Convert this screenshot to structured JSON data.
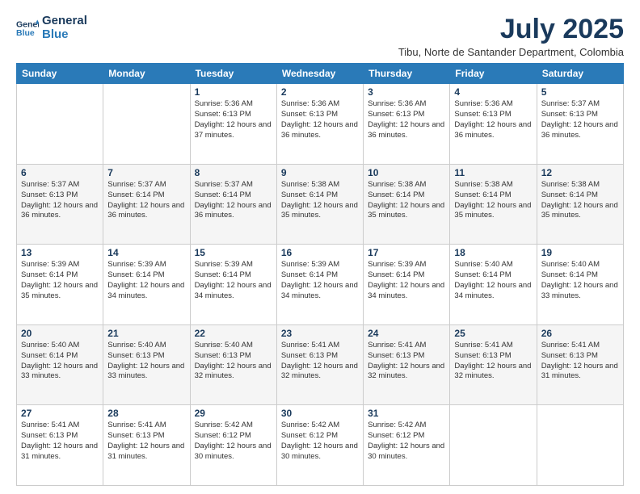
{
  "logo": {
    "line1": "General",
    "line2": "Blue"
  },
  "title": "July 2025",
  "subtitle": "Tibu, Norte de Santander Department, Colombia",
  "weekdays": [
    "Sunday",
    "Monday",
    "Tuesday",
    "Wednesday",
    "Thursday",
    "Friday",
    "Saturday"
  ],
  "weeks": [
    [
      {
        "day": "",
        "info": ""
      },
      {
        "day": "",
        "info": ""
      },
      {
        "day": "1",
        "info": "Sunrise: 5:36 AM\nSunset: 6:13 PM\nDaylight: 12 hours and 37 minutes."
      },
      {
        "day": "2",
        "info": "Sunrise: 5:36 AM\nSunset: 6:13 PM\nDaylight: 12 hours and 36 minutes."
      },
      {
        "day": "3",
        "info": "Sunrise: 5:36 AM\nSunset: 6:13 PM\nDaylight: 12 hours and 36 minutes."
      },
      {
        "day": "4",
        "info": "Sunrise: 5:36 AM\nSunset: 6:13 PM\nDaylight: 12 hours and 36 minutes."
      },
      {
        "day": "5",
        "info": "Sunrise: 5:37 AM\nSunset: 6:13 PM\nDaylight: 12 hours and 36 minutes."
      }
    ],
    [
      {
        "day": "6",
        "info": "Sunrise: 5:37 AM\nSunset: 6:13 PM\nDaylight: 12 hours and 36 minutes."
      },
      {
        "day": "7",
        "info": "Sunrise: 5:37 AM\nSunset: 6:14 PM\nDaylight: 12 hours and 36 minutes."
      },
      {
        "day": "8",
        "info": "Sunrise: 5:37 AM\nSunset: 6:14 PM\nDaylight: 12 hours and 36 minutes."
      },
      {
        "day": "9",
        "info": "Sunrise: 5:38 AM\nSunset: 6:14 PM\nDaylight: 12 hours and 35 minutes."
      },
      {
        "day": "10",
        "info": "Sunrise: 5:38 AM\nSunset: 6:14 PM\nDaylight: 12 hours and 35 minutes."
      },
      {
        "day": "11",
        "info": "Sunrise: 5:38 AM\nSunset: 6:14 PM\nDaylight: 12 hours and 35 minutes."
      },
      {
        "day": "12",
        "info": "Sunrise: 5:38 AM\nSunset: 6:14 PM\nDaylight: 12 hours and 35 minutes."
      }
    ],
    [
      {
        "day": "13",
        "info": "Sunrise: 5:39 AM\nSunset: 6:14 PM\nDaylight: 12 hours and 35 minutes."
      },
      {
        "day": "14",
        "info": "Sunrise: 5:39 AM\nSunset: 6:14 PM\nDaylight: 12 hours and 34 minutes."
      },
      {
        "day": "15",
        "info": "Sunrise: 5:39 AM\nSunset: 6:14 PM\nDaylight: 12 hours and 34 minutes."
      },
      {
        "day": "16",
        "info": "Sunrise: 5:39 AM\nSunset: 6:14 PM\nDaylight: 12 hours and 34 minutes."
      },
      {
        "day": "17",
        "info": "Sunrise: 5:39 AM\nSunset: 6:14 PM\nDaylight: 12 hours and 34 minutes."
      },
      {
        "day": "18",
        "info": "Sunrise: 5:40 AM\nSunset: 6:14 PM\nDaylight: 12 hours and 34 minutes."
      },
      {
        "day": "19",
        "info": "Sunrise: 5:40 AM\nSunset: 6:14 PM\nDaylight: 12 hours and 33 minutes."
      }
    ],
    [
      {
        "day": "20",
        "info": "Sunrise: 5:40 AM\nSunset: 6:14 PM\nDaylight: 12 hours and 33 minutes."
      },
      {
        "day": "21",
        "info": "Sunrise: 5:40 AM\nSunset: 6:13 PM\nDaylight: 12 hours and 33 minutes."
      },
      {
        "day": "22",
        "info": "Sunrise: 5:40 AM\nSunset: 6:13 PM\nDaylight: 12 hours and 32 minutes."
      },
      {
        "day": "23",
        "info": "Sunrise: 5:41 AM\nSunset: 6:13 PM\nDaylight: 12 hours and 32 minutes."
      },
      {
        "day": "24",
        "info": "Sunrise: 5:41 AM\nSunset: 6:13 PM\nDaylight: 12 hours and 32 minutes."
      },
      {
        "day": "25",
        "info": "Sunrise: 5:41 AM\nSunset: 6:13 PM\nDaylight: 12 hours and 32 minutes."
      },
      {
        "day": "26",
        "info": "Sunrise: 5:41 AM\nSunset: 6:13 PM\nDaylight: 12 hours and 31 minutes."
      }
    ],
    [
      {
        "day": "27",
        "info": "Sunrise: 5:41 AM\nSunset: 6:13 PM\nDaylight: 12 hours and 31 minutes."
      },
      {
        "day": "28",
        "info": "Sunrise: 5:41 AM\nSunset: 6:13 PM\nDaylight: 12 hours and 31 minutes."
      },
      {
        "day": "29",
        "info": "Sunrise: 5:42 AM\nSunset: 6:12 PM\nDaylight: 12 hours and 30 minutes."
      },
      {
        "day": "30",
        "info": "Sunrise: 5:42 AM\nSunset: 6:12 PM\nDaylight: 12 hours and 30 minutes."
      },
      {
        "day": "31",
        "info": "Sunrise: 5:42 AM\nSunset: 6:12 PM\nDaylight: 12 hours and 30 minutes."
      },
      {
        "day": "",
        "info": ""
      },
      {
        "day": "",
        "info": ""
      }
    ]
  ]
}
